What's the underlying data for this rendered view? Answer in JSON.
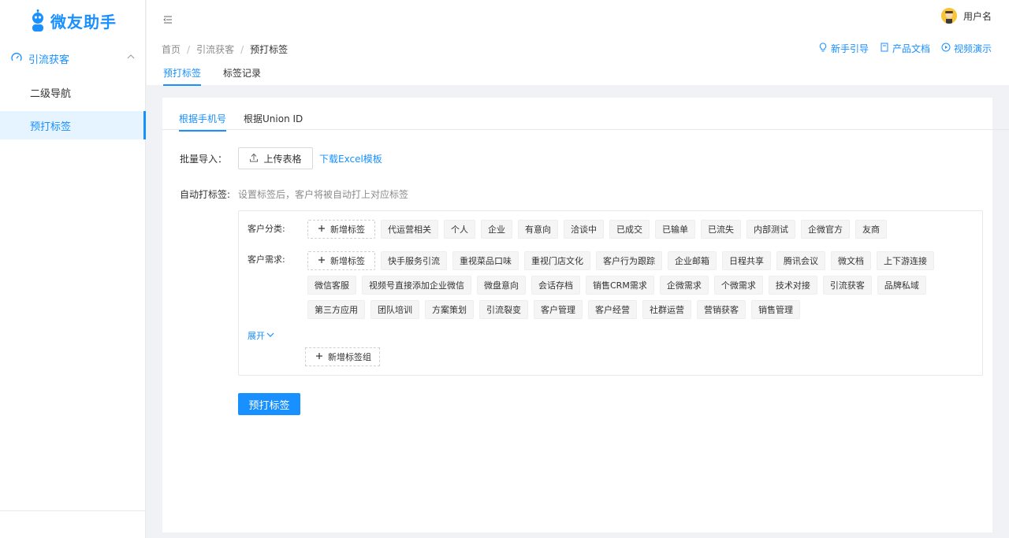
{
  "app": {
    "name": "微友助手"
  },
  "sidebar": {
    "group": {
      "label": "引流获客"
    },
    "items": [
      {
        "label": "二级导航"
      },
      {
        "label": "预打标签"
      }
    ]
  },
  "header": {
    "user_name": "用户名"
  },
  "breadcrumb": [
    "首页",
    "引流获客",
    "预打标签"
  ],
  "help_links": [
    {
      "label": "新手引导",
      "icon": "bulb-icon"
    },
    {
      "label": "产品文档",
      "icon": "document-icon"
    },
    {
      "label": "视频演示",
      "icon": "play-icon"
    }
  ],
  "page_tabs": [
    {
      "label": "预打标签"
    },
    {
      "label": "标签记录"
    }
  ],
  "sub_tabs": [
    {
      "label": "根据手机号"
    },
    {
      "label": "根据Union ID"
    }
  ],
  "import": {
    "label": "批量导入：",
    "upload_button": "上传表格",
    "download_link": "下载Excel模板"
  },
  "auto_tag": {
    "label": "自动打标签:",
    "hint": "设置标签后，客户将被自动打上对应标签"
  },
  "tag_box": {
    "add_tag_label": "新增标签",
    "categories": [
      {
        "label": "客户分类:",
        "tags": [
          "代运营相关",
          "个人",
          "企业",
          "有意向",
          "洽谈中",
          "已成交",
          "已输单",
          "已流失",
          "内部测试",
          "企微官方",
          "友商"
        ]
      },
      {
        "label": "客户需求:",
        "tags": [
          "快手服务引流",
          "重视菜品口味",
          "重视门店文化",
          "客户行为跟踪",
          "企业邮箱",
          "日程共享",
          "腾讯会议",
          "微文档",
          "上下游连接",
          "微信客服",
          "视频号直接添加企业微信",
          "微盘意向",
          "会话存档",
          "销售CRM需求",
          "企微需求",
          "个微需求",
          "技术对接",
          "引流获客",
          "品牌私域",
          "第三方应用",
          "团队培训",
          "方案策划",
          "引流裂变",
          "客户管理",
          "客户经营",
          "社群运营",
          "营销获客",
          "销售管理"
        ]
      }
    ],
    "expand_label": "展开",
    "add_group_label": "新增标签组"
  },
  "submit_button": "预打标签",
  "colors": {
    "primary": "#1890ff",
    "tag_bg": "#f5f5f5",
    "page_bg": "#f0f2f5"
  }
}
